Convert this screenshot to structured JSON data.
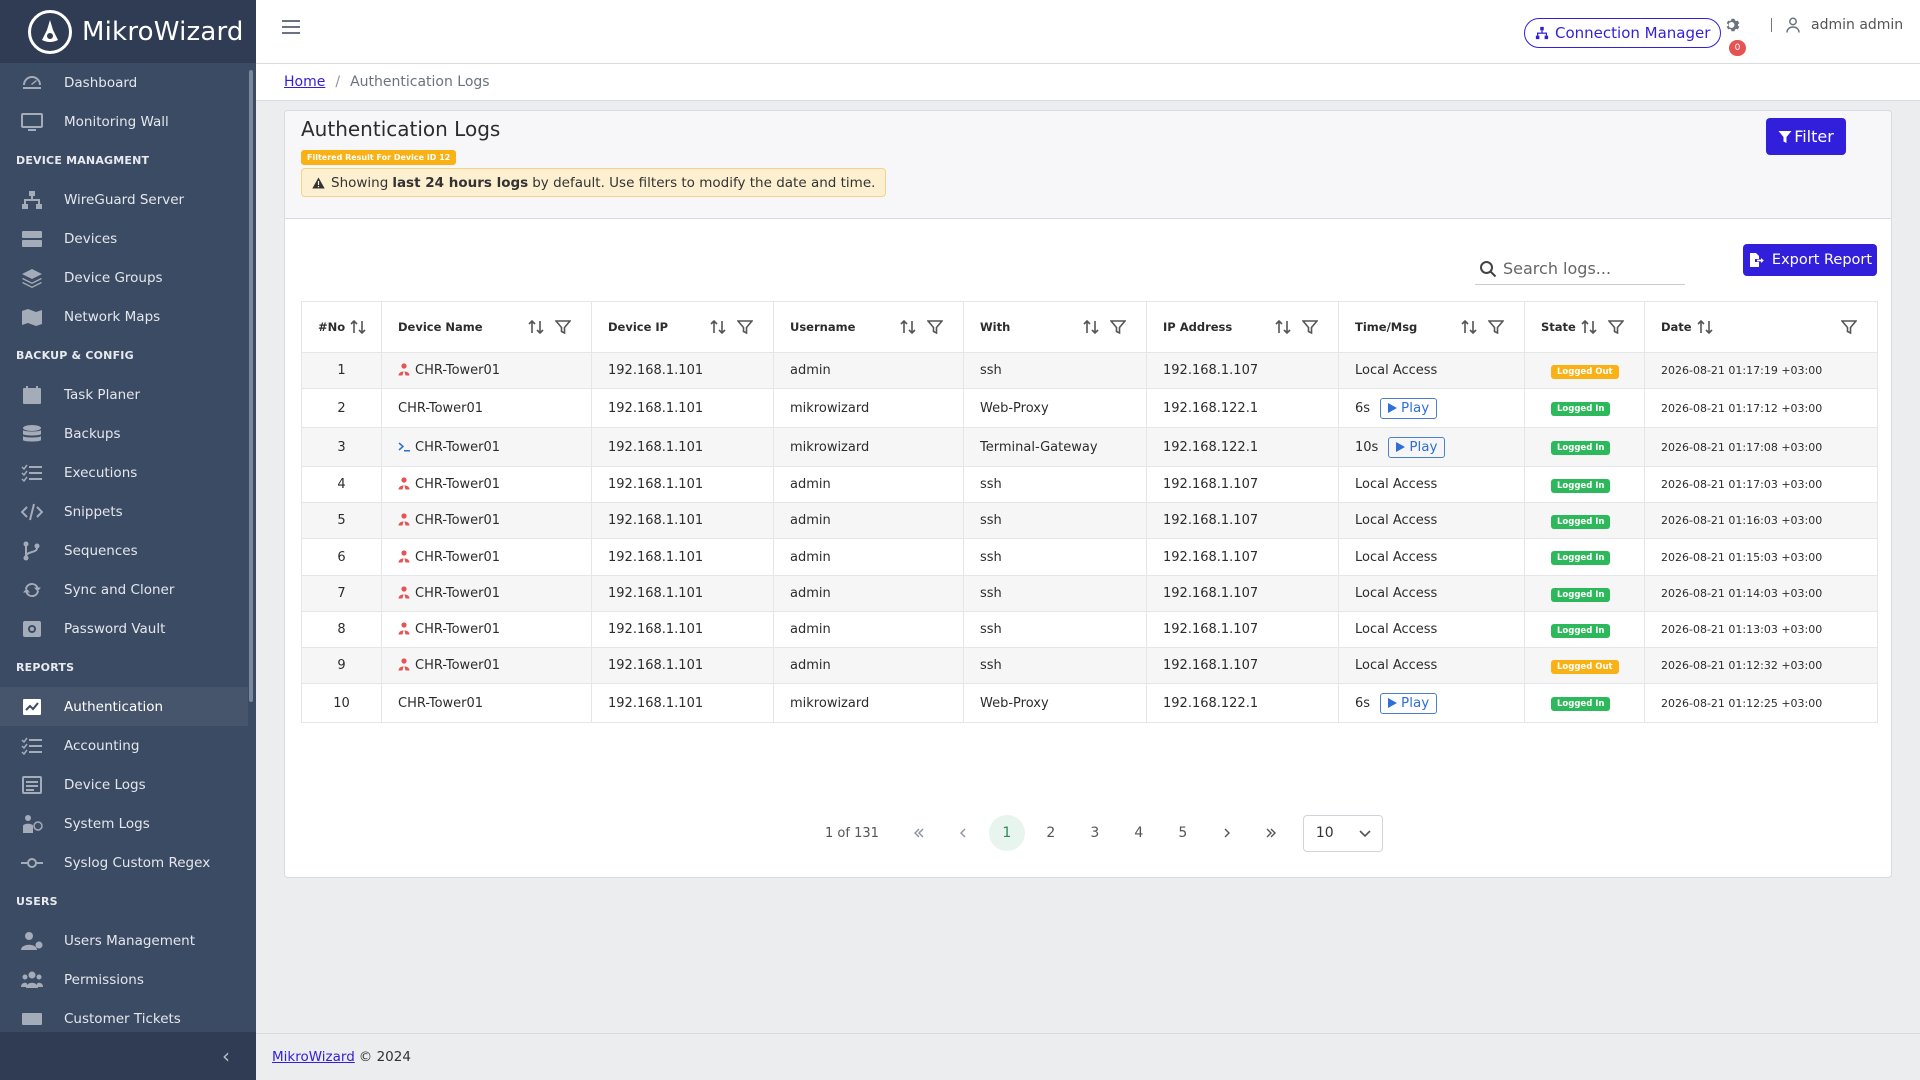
{
  "brand": {
    "name": "MikroWizard"
  },
  "sidebar": {
    "sections": [
      {
        "title": "",
        "items": [
          {
            "label": "Dashboard",
            "icon": "speedometer-icon"
          },
          {
            "label": "Monitoring Wall",
            "icon": "monitor-icon"
          }
        ]
      },
      {
        "title": "DEVICE MANAGMENT",
        "items": [
          {
            "label": "WireGuard Server",
            "icon": "network-icon"
          },
          {
            "label": "Devices",
            "icon": "server-icon"
          },
          {
            "label": "Device Groups",
            "icon": "layers-icon"
          },
          {
            "label": "Network Maps",
            "icon": "map-icon"
          }
        ]
      },
      {
        "title": "BACKUP & CONFIG",
        "items": [
          {
            "label": "Task Planer",
            "icon": "calendar-icon"
          },
          {
            "label": "Backups",
            "icon": "database-icon"
          },
          {
            "label": "Executions",
            "icon": "list-check-icon"
          },
          {
            "label": "Snippets",
            "icon": "code-icon"
          },
          {
            "label": "Sequences",
            "icon": "branch-icon"
          },
          {
            "label": "Sync and Cloner",
            "icon": "sync-icon"
          },
          {
            "label": "Password Vault",
            "icon": "vault-icon"
          }
        ]
      },
      {
        "title": "REPORTS",
        "items": [
          {
            "label": "Authentication",
            "icon": "chart-check-icon",
            "active": true
          },
          {
            "label": "Accounting",
            "icon": "list-check-icon"
          },
          {
            "label": "Device Logs",
            "icon": "list-icon"
          },
          {
            "label": "System Logs",
            "icon": "person-question-icon"
          },
          {
            "label": "Syslog Custom Regex",
            "icon": "commit-icon"
          }
        ]
      },
      {
        "title": "USERS",
        "items": [
          {
            "label": "Users Management",
            "icon": "user-gear-icon"
          },
          {
            "label": "Permissions",
            "icon": "users-icon"
          },
          {
            "label": "Customer Tickets",
            "icon": "ticket-icon"
          }
        ]
      }
    ],
    "collapse_icon": "chevron-left-icon"
  },
  "header": {
    "connection_manager": "Connection Manager",
    "notification_count": "0",
    "separator": "|",
    "user_name": "admin admin"
  },
  "breadcrumb": {
    "home": "Home",
    "sep": "/",
    "current": "Authentication Logs"
  },
  "page": {
    "title": "Authentication Logs",
    "filter_tag": "Filtered Result For Device ID 12",
    "warning_pre": "Showing",
    "warning_bold": "last 24 hours logs",
    "warning_post": "by default. Use filters to modify the date and time.",
    "filter_button": "Filter",
    "search_placeholder": "Search logs...",
    "export_button": "Export Report"
  },
  "table": {
    "columns": [
      {
        "label": "#No",
        "sort": true,
        "filter": false
      },
      {
        "label": "Device Name",
        "sort": true,
        "filter": true
      },
      {
        "label": "Device IP",
        "sort": true,
        "filter": true
      },
      {
        "label": "Username",
        "sort": true,
        "filter": true
      },
      {
        "label": "With",
        "sort": true,
        "filter": true
      },
      {
        "label": "IP Address",
        "sort": true,
        "filter": true
      },
      {
        "label": "Time/Msg",
        "sort": true,
        "filter": true
      },
      {
        "label": "State",
        "sort": true,
        "filter": true
      },
      {
        "label": "Date",
        "sort": true,
        "filter": true
      }
    ],
    "play_label": "Play",
    "rows": [
      {
        "no": "1",
        "device": "CHR-Tower01",
        "device_icon": "user-icon",
        "ip": "192.168.1.101",
        "username": "admin",
        "with": "ssh",
        "ip_address": "192.168.1.107",
        "time_msg": "Local Access",
        "play": false,
        "state": "Logged Out",
        "date": "2026-08-21 01:17:19 +03:00"
      },
      {
        "no": "2",
        "device": "CHR-Tower01",
        "device_icon": "",
        "ip": "192.168.1.101",
        "username": "mikrowizard",
        "with": "Web-Proxy",
        "ip_address": "192.168.122.1",
        "time_msg": "6s",
        "play": true,
        "state": "Logged In",
        "date": "2026-08-21 01:17:12 +03:00"
      },
      {
        "no": "3",
        "device": "CHR-Tower01",
        "device_icon": "terminal-icon",
        "ip": "192.168.1.101",
        "username": "mikrowizard",
        "with": "Terminal-Gateway",
        "ip_address": "192.168.122.1",
        "time_msg": "10s",
        "play": true,
        "state": "Logged In",
        "date": "2026-08-21 01:17:08 +03:00"
      },
      {
        "no": "4",
        "device": "CHR-Tower01",
        "device_icon": "user-icon",
        "ip": "192.168.1.101",
        "username": "admin",
        "with": "ssh",
        "ip_address": "192.168.1.107",
        "time_msg": "Local Access",
        "play": false,
        "state": "Logged In",
        "date": "2026-08-21 01:17:03 +03:00"
      },
      {
        "no": "5",
        "device": "CHR-Tower01",
        "device_icon": "user-icon",
        "ip": "192.168.1.101",
        "username": "admin",
        "with": "ssh",
        "ip_address": "192.168.1.107",
        "time_msg": "Local Access",
        "play": false,
        "state": "Logged In",
        "date": "2026-08-21 01:16:03 +03:00"
      },
      {
        "no": "6",
        "device": "CHR-Tower01",
        "device_icon": "user-icon",
        "ip": "192.168.1.101",
        "username": "admin",
        "with": "ssh",
        "ip_address": "192.168.1.107",
        "time_msg": "Local Access",
        "play": false,
        "state": "Logged In",
        "date": "2026-08-21 01:15:03 +03:00"
      },
      {
        "no": "7",
        "device": "CHR-Tower01",
        "device_icon": "user-icon",
        "ip": "192.168.1.101",
        "username": "admin",
        "with": "ssh",
        "ip_address": "192.168.1.107",
        "time_msg": "Local Access",
        "play": false,
        "state": "Logged In",
        "date": "2026-08-21 01:14:03 +03:00"
      },
      {
        "no": "8",
        "device": "CHR-Tower01",
        "device_icon": "user-icon",
        "ip": "192.168.1.101",
        "username": "admin",
        "with": "ssh",
        "ip_address": "192.168.1.107",
        "time_msg": "Local Access",
        "play": false,
        "state": "Logged In",
        "date": "2026-08-21 01:13:03 +03:00"
      },
      {
        "no": "9",
        "device": "CHR-Tower01",
        "device_icon": "user-icon",
        "ip": "192.168.1.101",
        "username": "admin",
        "with": "ssh",
        "ip_address": "192.168.1.107",
        "time_msg": "Local Access",
        "play": false,
        "state": "Logged Out",
        "date": "2026-08-21 01:12:32 +03:00"
      },
      {
        "no": "10",
        "device": "CHR-Tower01",
        "device_icon": "",
        "ip": "192.168.1.101",
        "username": "mikrowizard",
        "with": "Web-Proxy",
        "ip_address": "192.168.122.1",
        "time_msg": "6s",
        "play": true,
        "state": "Logged In",
        "date": "2026-08-21 01:12:25 +03:00"
      }
    ]
  },
  "pagination": {
    "info": "1 of 131",
    "pages": [
      "1",
      "2",
      "3",
      "4",
      "5"
    ],
    "current": "1",
    "page_size": "10"
  },
  "footer": {
    "link": "MikroWizard",
    "text": "© 2024"
  },
  "colors": {
    "primary": "#321fdb",
    "sidebar": "#3c4b64",
    "success": "#2eb85c",
    "warning": "#f9b115"
  }
}
